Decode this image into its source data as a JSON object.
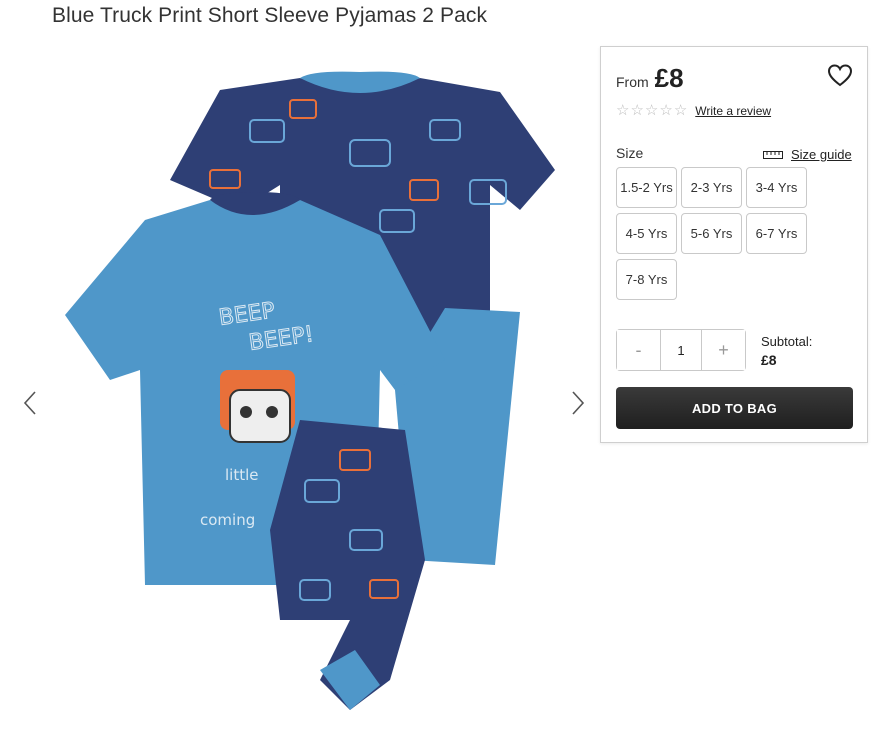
{
  "product": {
    "title": "Blue Truck Print Short Sleeve Pyjamas 2 Pack",
    "image_alt": "Blue truck print pyjamas two pack"
  },
  "pricing": {
    "from_label": "From",
    "price": "£8"
  },
  "rating": {
    "stars_filled": 0,
    "stars_total": 5,
    "review_link": "Write a review"
  },
  "sizes": {
    "label": "Size",
    "guide_label": "Size guide",
    "options": [
      "1.5-2 Yrs",
      "2-3 Yrs",
      "3-4 Yrs",
      "4-5 Yrs",
      "5-6 Yrs",
      "6-7 Yrs",
      "7-8 Yrs"
    ]
  },
  "quantity": {
    "minus": "-",
    "value": "1",
    "plus": "+"
  },
  "subtotal": {
    "label": "Subtotal:",
    "value": "£8"
  },
  "cart": {
    "add_label": "ADD TO BAG"
  },
  "colors": {
    "shirt_light": "#4f97c9",
    "shirt_dark": "#2e3f75",
    "accent_orange": "#e8703a",
    "button_dark": "#2b2b2b"
  },
  "icons": {
    "prev": "chevron-left-icon",
    "next": "chevron-right-icon",
    "wishlist": "heart-icon",
    "size_guide": "ruler-icon",
    "star": "star-outline-icon"
  }
}
